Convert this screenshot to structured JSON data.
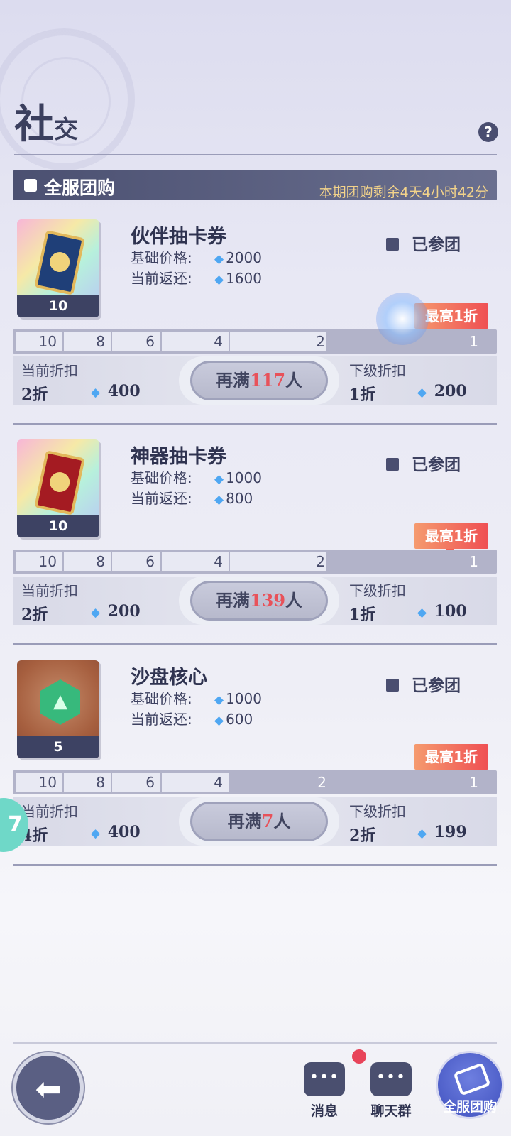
{
  "header": {
    "title_big": "社",
    "title_small": "交",
    "help_label": "?"
  },
  "banner": {
    "title": "全服团购",
    "timer": "本期团购剩余4天4小时42分"
  },
  "labels": {
    "base_price": "基础价格:",
    "current_return": "当前返还:",
    "joined": "已参团",
    "max_tag": "最高1折",
    "current_discount": "当前折扣",
    "next_discount": "下级折扣",
    "need_prefix": "再满",
    "need_suffix": "人"
  },
  "ticks": [
    "10",
    "8",
    "6",
    "4",
    "2",
    "1"
  ],
  "items": [
    {
      "name": "伙伴抽卡券",
      "card_count": "10",
      "base_price": "2000",
      "current_return": "1600",
      "progress_fill_tick": "2",
      "current_discount": "2折",
      "current_gems": "400",
      "need_count": "117",
      "next_discount": "1折",
      "next_gems": "200"
    },
    {
      "name": "神器抽卡券",
      "card_count": "10",
      "base_price": "1000",
      "current_return": "800",
      "progress_fill_tick": "2",
      "current_discount": "2折",
      "current_gems": "200",
      "need_count": "139",
      "next_discount": "1折",
      "next_gems": "100"
    },
    {
      "name": "沙盘核心",
      "card_count": "5",
      "base_price": "1000",
      "current_return": "600",
      "progress_fill_tick": "4",
      "current_discount": "4折",
      "current_gems": "400",
      "need_count": "7",
      "next_discount": "2折",
      "next_gems": "199"
    }
  ],
  "bottom_nav": {
    "back_icon": "arrow-left-icon",
    "messages": "消息",
    "chat_group": "聊天群",
    "group_buy": "全服团购",
    "messages_icon": "•••",
    "chat_icon": "•••"
  },
  "side_tab": "7"
}
